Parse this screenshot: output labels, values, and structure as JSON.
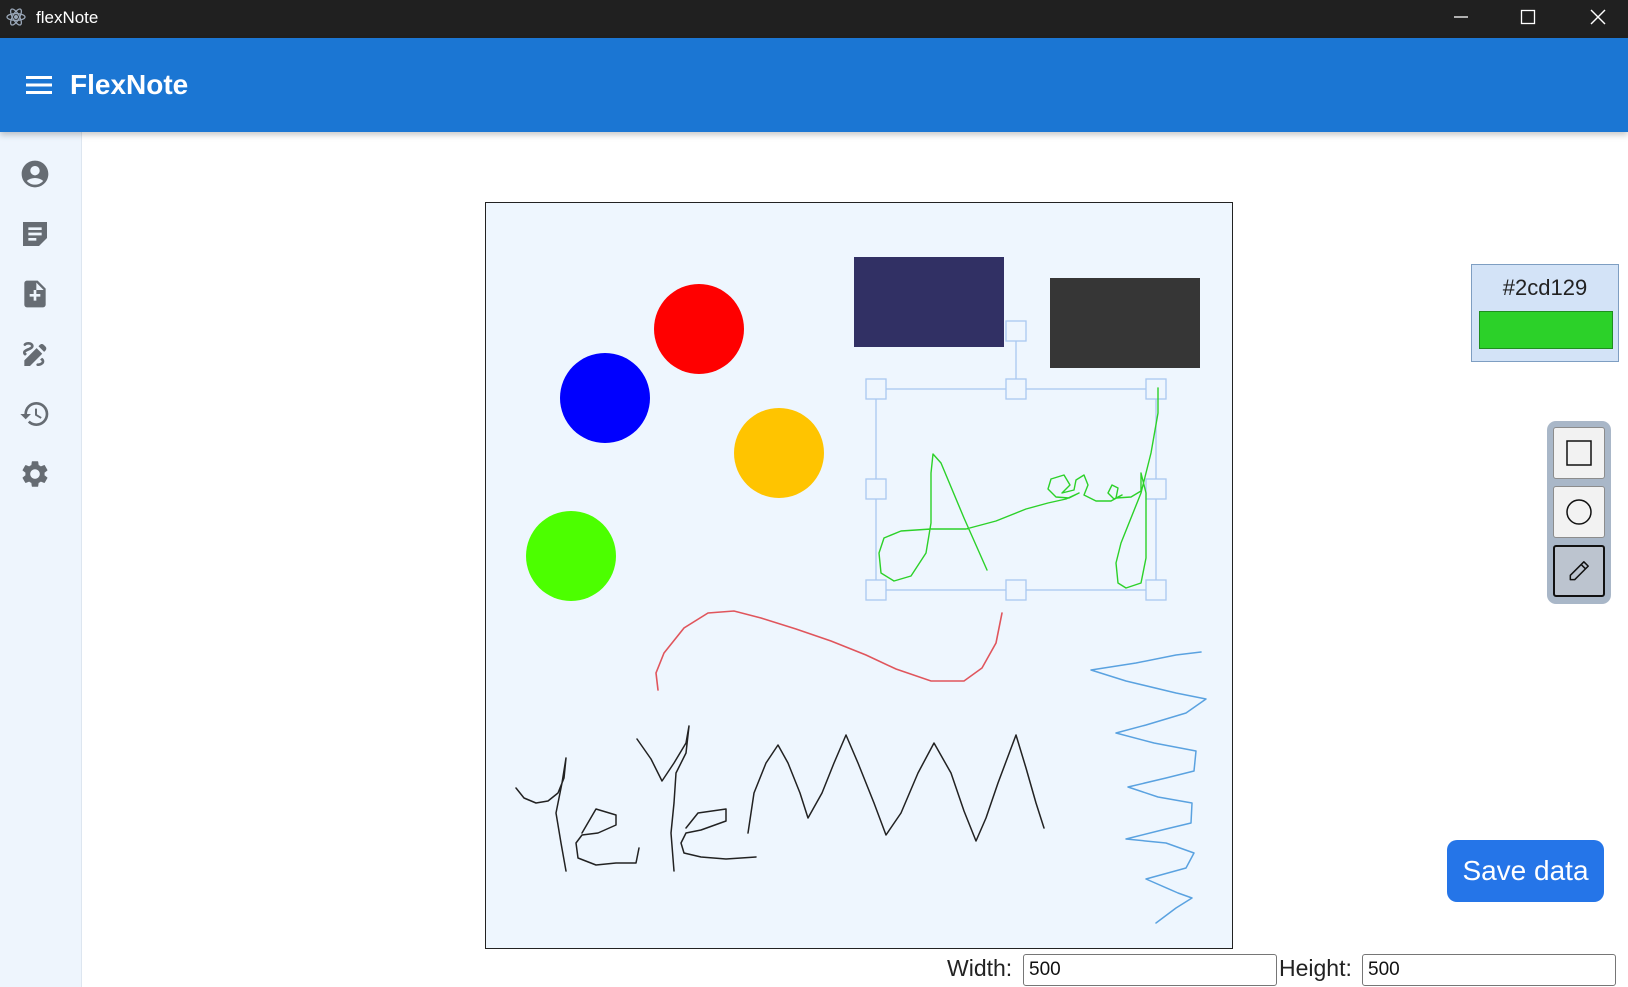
{
  "window": {
    "title": "flexNote",
    "controls": [
      "minimize-icon",
      "maximize-icon",
      "close-icon"
    ]
  },
  "appbar": {
    "menu_icon": "hamburger-menu-icon",
    "title": "FlexNote"
  },
  "sidebar": {
    "items": [
      {
        "name": "profile",
        "icon": "account-circle-icon"
      },
      {
        "name": "notes",
        "icon": "note-icon"
      },
      {
        "name": "new-note",
        "icon": "note-add-icon"
      },
      {
        "name": "draw",
        "icon": "draw-icon"
      },
      {
        "name": "history",
        "icon": "history-icon"
      },
      {
        "name": "settings",
        "icon": "gear-icon"
      }
    ]
  },
  "canvas": {
    "background": "#eef6fe",
    "circle_colors": [
      "#ff0000",
      "#0000ff",
      "#ffc400",
      "#4cff00"
    ],
    "rectangle_colors": [
      "#313064",
      "#363636"
    ],
    "stroke_colors": [
      "#2cd129",
      "#e0555c",
      "#222222",
      "#5aa2e0"
    ],
    "selection_color": "#a9c8f0"
  },
  "color_picker": {
    "hex": "#2cd129",
    "swatch_color": "#2cd129"
  },
  "tools": [
    {
      "name": "rectangle",
      "icon": "square-icon",
      "active": false
    },
    {
      "name": "circle",
      "icon": "circle-icon",
      "active": false
    },
    {
      "name": "pencil",
      "icon": "pencil-icon",
      "active": true
    }
  ],
  "save_label": "Save data",
  "size": {
    "width_label": "Width:",
    "width_value": "500",
    "height_label": "Height:",
    "height_value": "500"
  }
}
